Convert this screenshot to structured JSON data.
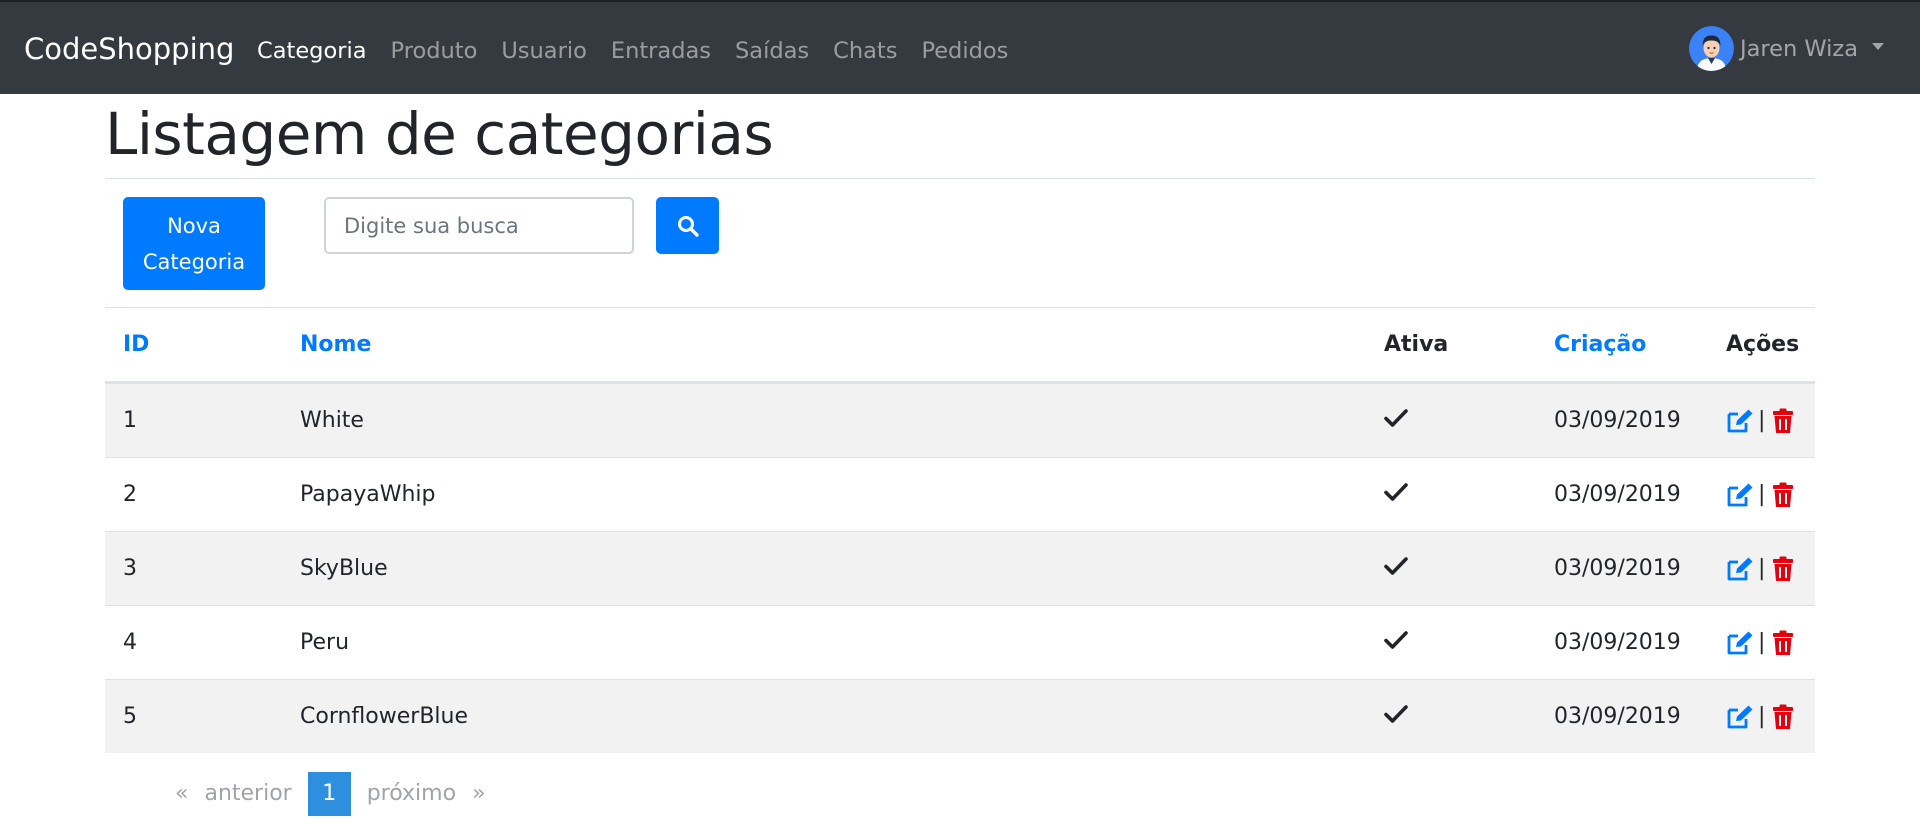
{
  "navbar": {
    "brand": "CodeShopping",
    "links": [
      {
        "label": "Categoria",
        "active": true
      },
      {
        "label": "Produto",
        "active": false
      },
      {
        "label": "Usuario",
        "active": false
      },
      {
        "label": "Entradas",
        "active": false
      },
      {
        "label": "Saídas",
        "active": false
      },
      {
        "label": "Chats",
        "active": false
      },
      {
        "label": "Pedidos",
        "active": false
      }
    ],
    "user": {
      "name": "Jaren Wiza",
      "avatar_icon": "user-avatar-icon"
    }
  },
  "page": {
    "title": "Listagem de categorias"
  },
  "toolbar": {
    "new_button_line1": "Nova",
    "new_button_line2": "Categoria",
    "search_placeholder": "Digite sua busca",
    "search_icon": "search-icon"
  },
  "table": {
    "headers": {
      "id": "ID",
      "name": "Nome",
      "active": "Ativa",
      "created": "Criação",
      "actions": "Ações"
    },
    "rows": [
      {
        "id": "1",
        "name": "White",
        "active": true,
        "created": "03/09/2019"
      },
      {
        "id": "2",
        "name": "PapayaWhip",
        "active": true,
        "created": "03/09/2019"
      },
      {
        "id": "3",
        "name": "SkyBlue",
        "active": true,
        "created": "03/09/2019"
      },
      {
        "id": "4",
        "name": "Peru",
        "active": true,
        "created": "03/09/2019"
      },
      {
        "id": "5",
        "name": "CornflowerBlue",
        "active": true,
        "created": "03/09/2019"
      }
    ],
    "action_separator": "|"
  },
  "pagination": {
    "first": "«",
    "previous": "anterior",
    "current": "1",
    "next": "próximo",
    "last": "»"
  },
  "colors": {
    "navbar_bg": "#343a40",
    "primary": "#007bff",
    "danger": "#dc3545",
    "stripe": "#f2f2f2",
    "page_active": "#2f8fdf"
  }
}
